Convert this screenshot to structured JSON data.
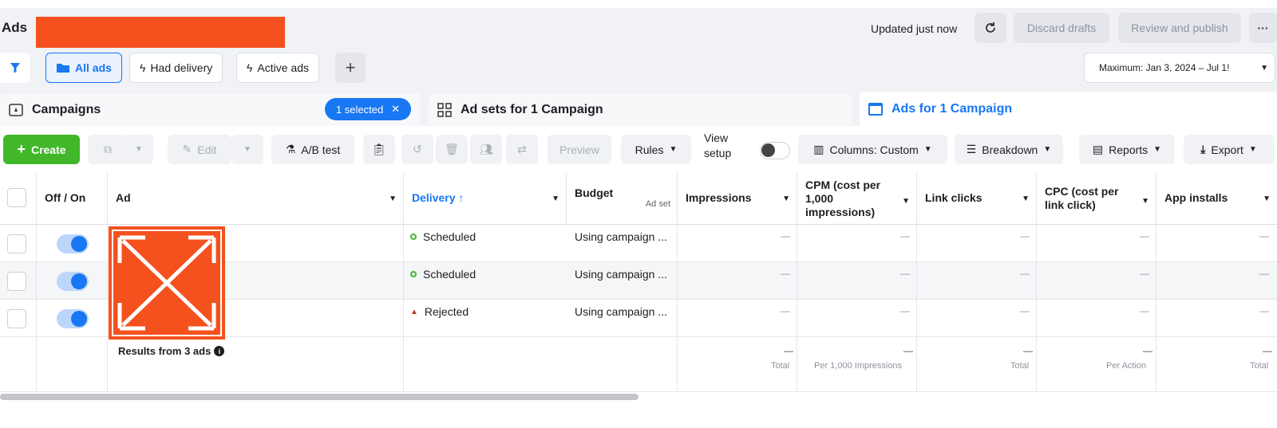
{
  "header": {
    "title": "Ads",
    "status": "Updated just now",
    "discard_label": "Discard drafts",
    "publish_label": "Review and publish",
    "more_label": "···"
  },
  "filters": {
    "all_ads": "All ads",
    "had_delivery": "Had delivery",
    "active_ads": "Active ads",
    "add": "+",
    "date_range": "Maximum: Jan 3, 2024 – Jul 1!"
  },
  "tabs": {
    "campaigns": "Campaigns",
    "selected": "1 selected",
    "ad_sets": "Ad sets for 1 Campaign",
    "ads": "Ads for 1 Campaign"
  },
  "toolbar": {
    "create": "Create",
    "edit": "Edit",
    "ab_test": "A/B test",
    "preview": "Preview",
    "rules": "Rules",
    "view_setup_1": "View",
    "view_setup_2": "setup",
    "columns": "Columns: Custom",
    "breakdown": "Breakdown",
    "reports": "Reports",
    "export": "Export"
  },
  "table": {
    "headers": {
      "off_on": "Off / On",
      "ad": "Ad",
      "delivery": "Delivery ↑",
      "budget": "Budget",
      "budget_sub": "Ad set",
      "impressions": "Impressions",
      "cpm": "CPM (cost per 1,000 impressions)",
      "link_clicks": "Link clicks",
      "cpc": "CPC (cost per link click)",
      "app_installs": "App installs"
    },
    "rows": [
      {
        "delivery": "Scheduled",
        "budget": "Using campaign ...",
        "impressions": "—",
        "cpm": "—",
        "link_clicks": "—",
        "cpc": "—",
        "app_installs": "—"
      },
      {
        "delivery": "Scheduled",
        "budget": "Using campaign ...",
        "impressions": "—",
        "cpm": "—",
        "link_clicks": "—",
        "cpc": "—",
        "app_installs": "—"
      },
      {
        "delivery": "Rejected",
        "budget": "Using campaign ...",
        "impressions": "—",
        "cpm": "—",
        "link_clicks": "—",
        "cpc": "—",
        "app_installs": "—"
      }
    ],
    "footer": {
      "label": "Results from 3 ads",
      "impressions": "—",
      "impressions_sub": "Total",
      "cpm": "—",
      "cpm_sub": "Per 1,000 Impressions",
      "link_clicks": "—",
      "link_clicks_sub": "Total",
      "cpc": "—",
      "cpc_sub": "Per Action",
      "app_installs": "—",
      "app_installs_sub": "Total"
    }
  },
  "colors": {
    "accent": "#1877f2",
    "create": "#42b72a",
    "redaction": "#f4511e",
    "scheduled": "#42b72a",
    "rejected": "#c0392b"
  }
}
